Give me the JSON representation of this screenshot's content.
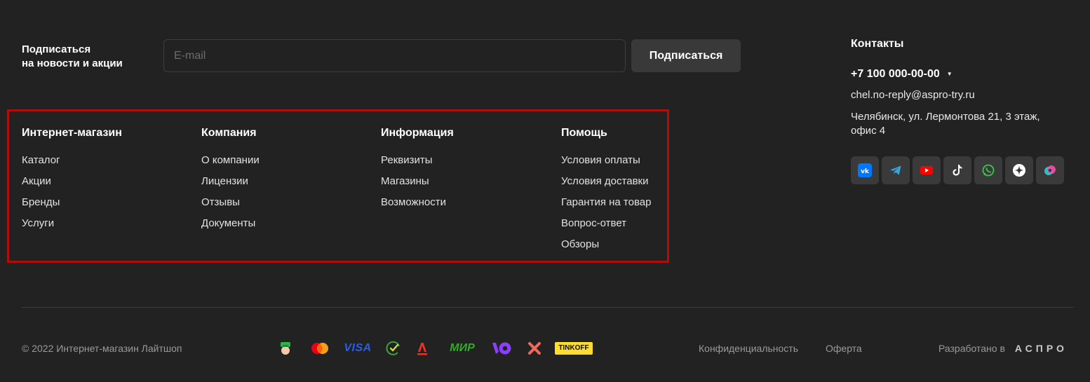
{
  "subscribe": {
    "label_line1": "Подписаться",
    "label_line2": "на новости и акции",
    "email_placeholder": "E-mail",
    "email_value": "",
    "button_label": "Подписаться"
  },
  "menu": {
    "columns": [
      {
        "title": "Интернет-магазин",
        "items": [
          "Каталог",
          "Акции",
          "Бренды",
          "Услуги"
        ]
      },
      {
        "title": "Компания",
        "items": [
          "О компании",
          "Лицензии",
          "Отзывы",
          "Документы"
        ]
      },
      {
        "title": "Информация",
        "items": [
          "Реквизиты",
          "Магазины",
          "Возможности"
        ]
      },
      {
        "title": "Помощь",
        "items": [
          "Условия оплаты",
          "Условия доставки",
          "Гарантия на товар",
          "Вопрос-ответ",
          "Обзоры"
        ]
      }
    ],
    "highlight_color": "#b20c0c"
  },
  "contacts": {
    "title": "Контакты",
    "phone": "+7 100 000-00-00",
    "email": "chel.no-reply@aspro-try.ru",
    "address": "Челябинск, ул. Лермонтова 21, 3 этаж, офис 4",
    "socials": [
      "vk-icon",
      "telegram-icon",
      "youtube-icon",
      "tiktok-icon",
      "whatsapp-icon",
      "zen-icon",
      "odnoklassniki-icon"
    ]
  },
  "footer": {
    "copyright": "© 2022 Интернет-магазин Лайтшоп",
    "payments": [
      "sber-icon",
      "mastercard-icon",
      "visa-icon",
      "sbp-icon",
      "alfa-icon",
      "mir-icon",
      "yoomoney-icon",
      "halva-icon",
      "tinkoff-icon"
    ],
    "visa_text": "VISA",
    "mir_text": "МИР",
    "tinkoff_text": "TINKOFF",
    "privacy": "Конфиденциальность",
    "offer": "Оферта",
    "developed_by": "Разработано в",
    "developer_logo": "АСПРО"
  },
  "colors": {
    "background": "#222222",
    "button": "#393939",
    "social_bg": "#3a3a3a"
  }
}
